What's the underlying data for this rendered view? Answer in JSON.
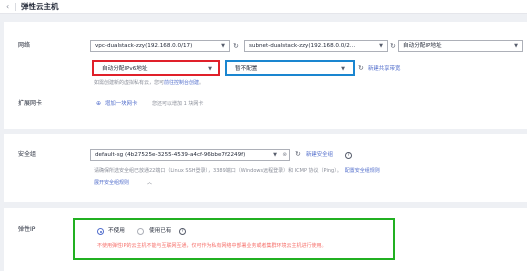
{
  "header": {
    "title": "弹性云主机"
  },
  "network": {
    "label": "网络",
    "vpc_value": "vpc-dualstack-zzy(192.168.0.0/17)",
    "subnet_value": "subnet-dualstack-zzy(192.168.0.0/2...",
    "ipv4_value": "自动分配IP地址",
    "ipv6_value": "自动分配IPv6地址",
    "bandwidth_value": "暂不配置",
    "new_shared_bandwidth_link": "新建共享带宽",
    "hint_prefix": "如需创建新的虚拟私有云，您可",
    "hint_link": "前往控制台创建",
    "hint_suffix": "。"
  },
  "ext_nic": {
    "label": "扩展网卡",
    "add_link": "增加一块网卡",
    "remaining": "您还可以增加 1 块网卡"
  },
  "security_group": {
    "label": "安全组",
    "value": "default-sg (4b27525e-3255-4539-a4cf-96bbe7f2249f)",
    "new_link": "新建安全组",
    "hint": "请确保所选安全组已放通22端口（Linux SSH登录），3389端口（Windows远程登录）和 ICMP 协议（Ping）。",
    "configure_link": "配置安全组规则",
    "expand_link": "展开安全组规则"
  },
  "eip": {
    "label": "弹性IP",
    "option_none": "不使用",
    "option_existing": "使用已有",
    "warning": "不使用弹性IP的云主机不能与互联网互通，仅可作为私有网络中部署业务或者集群环境云主机进行使用。"
  },
  "colors": {
    "link": "#526ecc",
    "warning": "#f66f6a",
    "red_box": "#e0202a",
    "blue_box": "#1a86d0",
    "green_box": "#21b021"
  }
}
